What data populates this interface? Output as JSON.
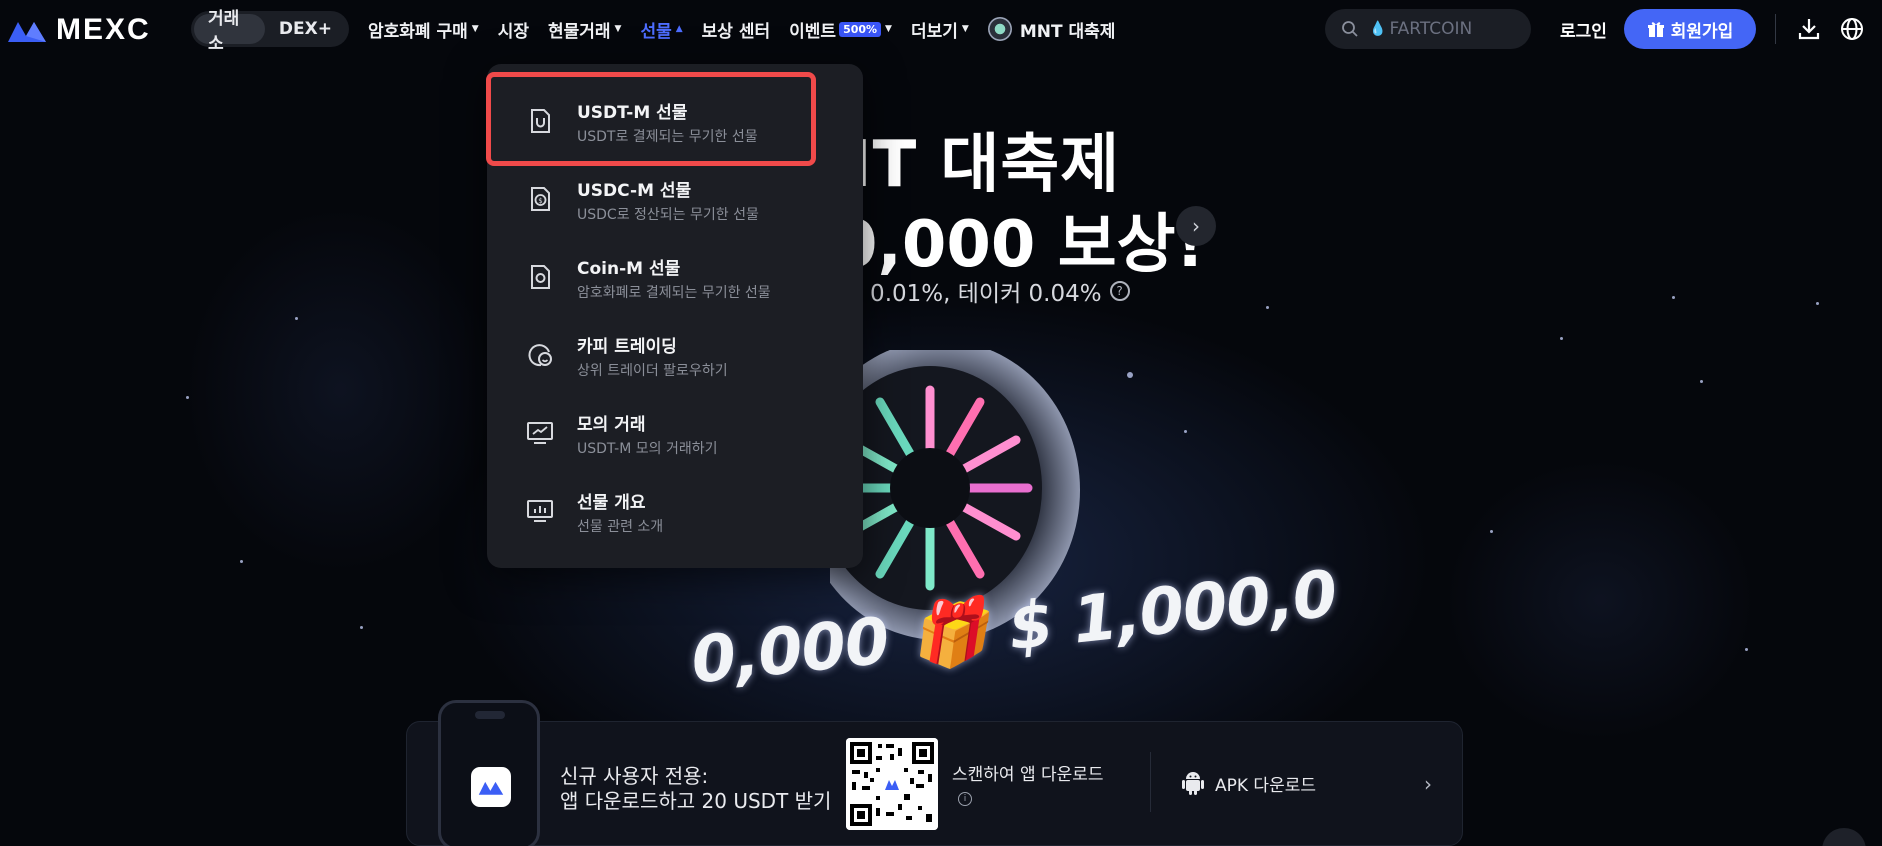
{
  "brand": {
    "name": "MEXC",
    "accent": "#4466f6",
    "highlight": "#f04a4a"
  },
  "nav": {
    "segments": [
      "거래소",
      "DEX+"
    ],
    "items": [
      {
        "label": "암호화폐 구매",
        "caret": true
      },
      {
        "label": "시장",
        "caret": false
      },
      {
        "label": "현물거래",
        "caret": true
      },
      {
        "label": "선물",
        "caret": true,
        "active": true
      },
      {
        "label": "보상 센터",
        "caret": false
      },
      {
        "label": "이벤트",
        "badge": "500%",
        "caret": true
      },
      {
        "label": "더보기",
        "caret": true
      },
      {
        "label": "MNT 대축제",
        "caret": false
      }
    ],
    "search_placeholder": "FARTCOIN",
    "login": "로그인",
    "signup": "회원가입"
  },
  "hero": {
    "line1": "NT 대축제",
    "line2": "0,000 보상!",
    "line3": "| 0.01%, 테이커 0.04%",
    "coin_banner": "0,000 🎁 $ 1,000,0"
  },
  "dropdown": {
    "items": [
      {
        "title": "USDT-M 선물",
        "subtitle": "USDT로 결제되는 무기한 선물",
        "icon": "usdt-m-icon"
      },
      {
        "title": "USDC-M 선물",
        "subtitle": "USDC로 정산되는 무기한 선물",
        "icon": "usdc-m-icon"
      },
      {
        "title": "Coin-M 선물",
        "subtitle": "암호화폐로 결제되는 무기한 선물",
        "icon": "coin-m-icon"
      },
      {
        "title": "카피 트레이딩",
        "subtitle": "상위 트레이더 팔로우하기",
        "icon": "copy-trading-icon"
      },
      {
        "title": "모의 거래",
        "subtitle": "USDT-M 모의 거래하기",
        "icon": "demo-trading-icon"
      },
      {
        "title": "선물 개요",
        "subtitle": "선물 관련 소개",
        "icon": "futures-overview-icon"
      }
    ]
  },
  "banner": {
    "line1": "신규 사용자 전용:",
    "line2": "앱 다운로드하고 20 USDT 받기",
    "scan": "스캔하여 앱 다운로드",
    "apk": "APK 다운로드"
  }
}
